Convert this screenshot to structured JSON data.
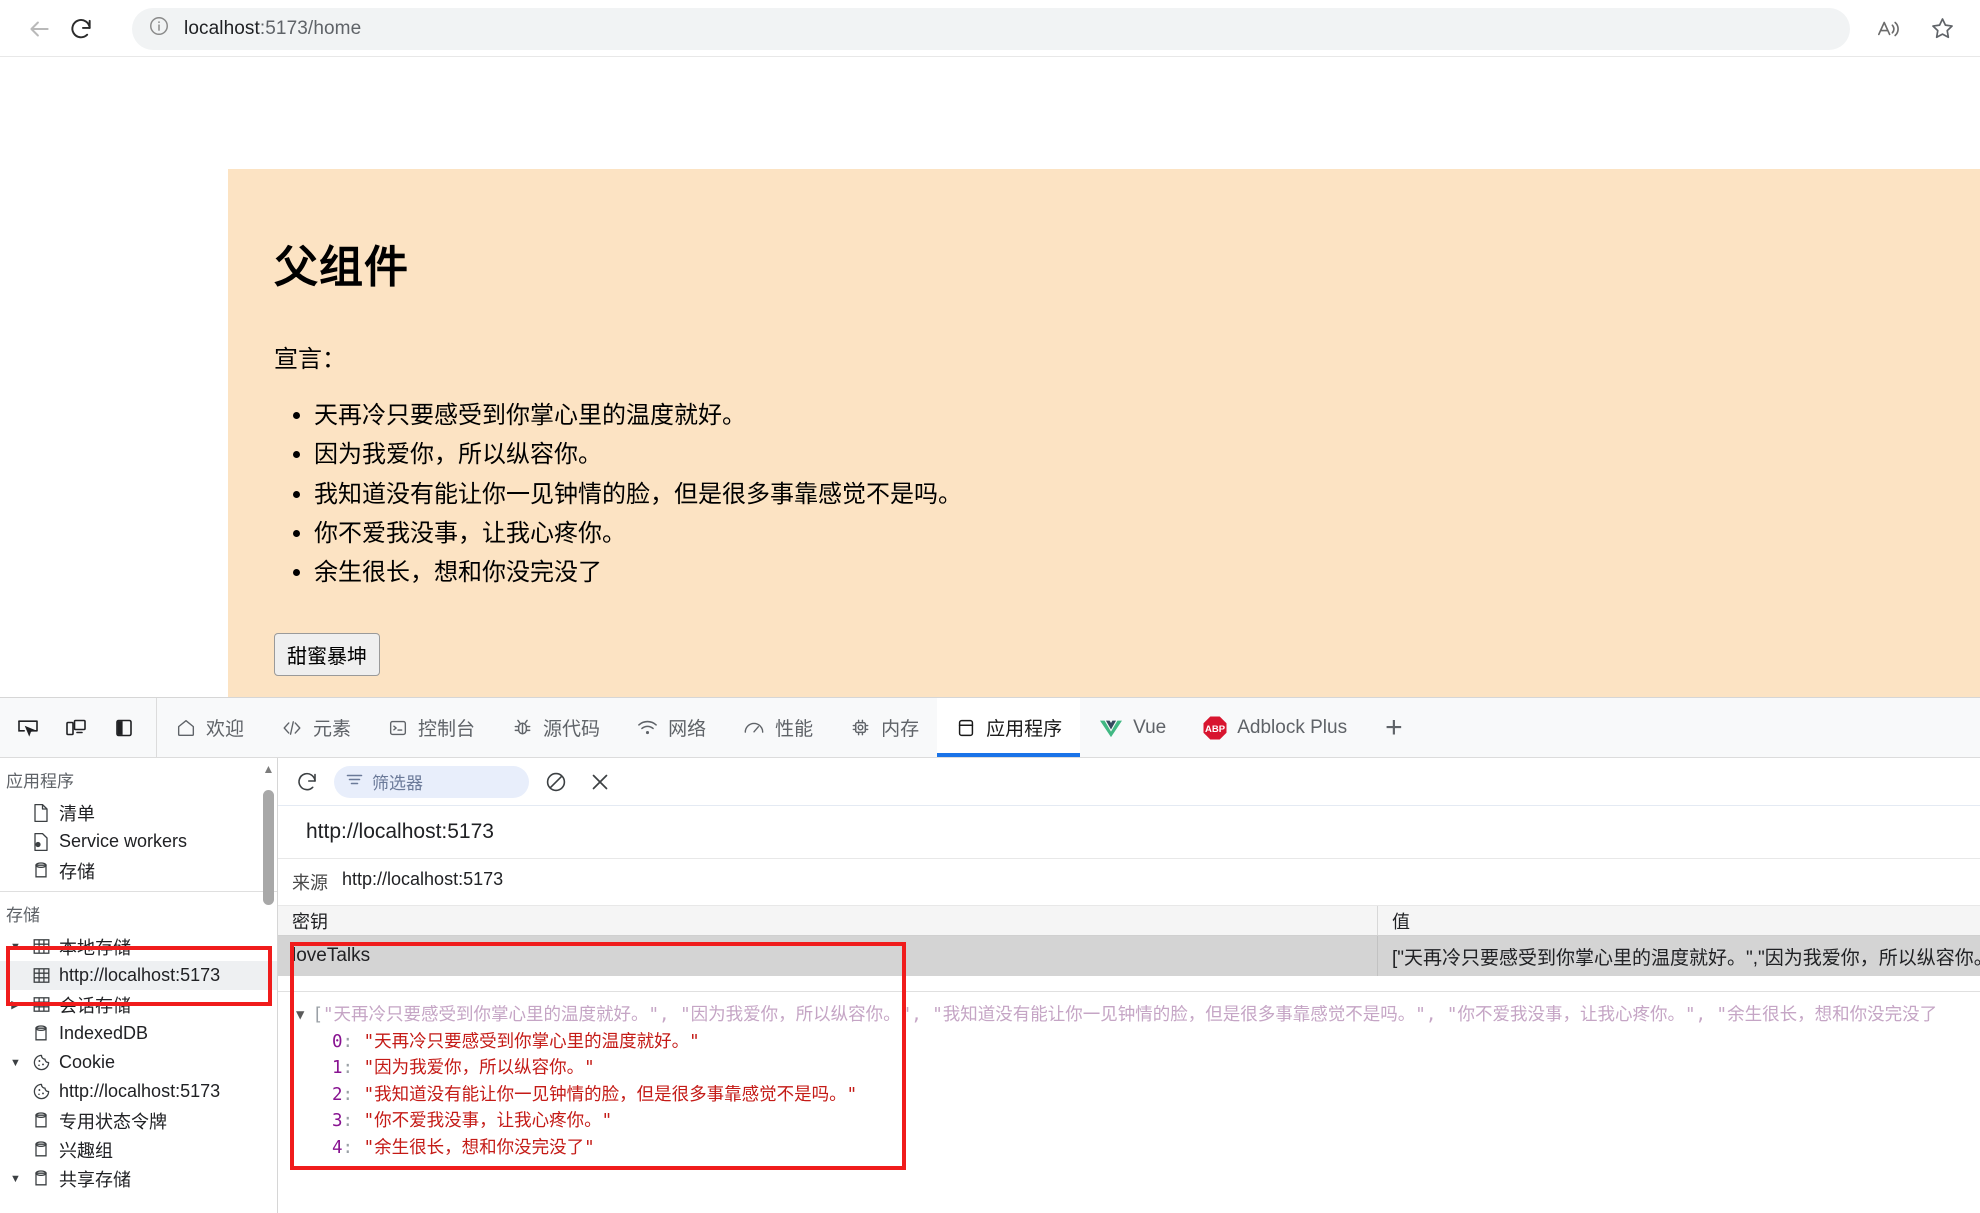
{
  "browser": {
    "back_icon": "back-arrow-icon",
    "reload_icon": "reload-icon",
    "info_icon": "info-circle-icon",
    "url_host": "localhost",
    "url_path": ":5173/home",
    "read_aloud_icon": "read-aloud-icon",
    "favorite_icon": "star-icon"
  },
  "page": {
    "heading": "父组件",
    "subtitle": "宣言：",
    "list": [
      "天再冷只要感受到你掌心里的温度就好。",
      "因为我爱你，所以纵容你。",
      "我知道没有能让你一见钟情的脸，但是很多事靠感觉不是吗。",
      "你不爱我没事，让我心疼你。",
      "余生很长，想和你没完没了"
    ],
    "button_label": "甜蜜暴坤",
    "background_color": "#fce3c3"
  },
  "devtools": {
    "tool_icons": [
      "inspect-element-icon",
      "device-toolbar-icon",
      "dock-side-icon"
    ],
    "tabs": [
      {
        "label": "欢迎",
        "icon": "home-icon",
        "active": false
      },
      {
        "label": "元素",
        "icon": "code-brackets-icon",
        "active": false
      },
      {
        "label": "控制台",
        "icon": "console-icon",
        "active": false
      },
      {
        "label": "源代码",
        "icon": "bug-icon",
        "active": false
      },
      {
        "label": "网络",
        "icon": "wifi-icon",
        "active": false
      },
      {
        "label": "性能",
        "icon": "gauge-icon",
        "active": false
      },
      {
        "label": "内存",
        "icon": "chip-icon",
        "active": false
      },
      {
        "label": "应用程序",
        "icon": "application-icon",
        "active": true
      },
      {
        "label": "Vue",
        "icon": "vue-logo-icon",
        "active": false
      },
      {
        "label": "Adblock Plus",
        "icon": "abp-logo-icon",
        "active": false
      }
    ],
    "add_tab_label": "+",
    "active_tab_accent": "#1a73e8",
    "sidebar": {
      "section_application": {
        "title": "应用程序",
        "items": [
          {
            "label": "清单",
            "icon": "manifest-file-icon"
          },
          {
            "label": "Service workers",
            "icon": "service-worker-icon"
          },
          {
            "label": "存储",
            "icon": "storage-cylinder-icon"
          }
        ]
      },
      "section_storage": {
        "title": "存储",
        "items": [
          {
            "label": "本地存储",
            "icon": "table-grid-icon",
            "arrow": "▼",
            "indent": 0,
            "selected": false,
            "highlighted": true
          },
          {
            "label": "http://localhost:5173",
            "icon": "table-grid-icon",
            "arrow": "",
            "indent": 1,
            "selected": true,
            "highlighted": true
          },
          {
            "label": "会话存储",
            "icon": "table-grid-icon",
            "arrow": "▶",
            "indent": 0,
            "selected": false,
            "highlighted": false
          },
          {
            "label": "IndexedDB",
            "icon": "storage-cylinder-icon",
            "arrow": "",
            "indent": 0,
            "selected": false,
            "highlighted": false
          },
          {
            "label": "Cookie",
            "icon": "cookie-icon",
            "arrow": "▼",
            "indent": 0,
            "selected": false,
            "highlighted": false
          },
          {
            "label": "http://localhost:5173",
            "icon": "cookie-icon",
            "arrow": "",
            "indent": 1,
            "selected": false,
            "highlighted": false
          },
          {
            "label": "专用状态令牌",
            "icon": "storage-cylinder-icon",
            "arrow": "",
            "indent": 0,
            "selected": false,
            "highlighted": false
          },
          {
            "label": "兴趣组",
            "icon": "storage-cylinder-icon",
            "arrow": "",
            "indent": 0,
            "selected": false,
            "highlighted": false
          },
          {
            "label": "共享存储",
            "icon": "storage-cylinder-icon",
            "arrow": "▼",
            "indent": 0,
            "selected": false,
            "highlighted": false
          }
        ]
      }
    },
    "toolbar": {
      "refresh_icon": "refresh-icon",
      "filter_placeholder": "筛选器",
      "filter_value": "",
      "filter_icon": "filter-lines-icon",
      "clear_all_icon": "clear-all-circle-slash-icon",
      "delete_selected_icon": "delete-x-icon"
    },
    "storage_panel": {
      "origin_title": "http://localhost:5173",
      "origin_label": "来源",
      "origin_value": "http://localhost:5173",
      "table": {
        "columns": [
          "密钥",
          "值"
        ],
        "rows": [
          {
            "key": "loveTalks",
            "value": "[\"天再冷只要感受到你掌心里的温度就好。\",\"因为我爱你，所以纵容你。\",\"我知道没有能让你一见钟情的脸，但是很多事靠感觉不是吗。\",\"你不爱我没事，让我心疼你。\",\"余生很长，想和你没完没了\"]",
            "selected": true
          }
        ]
      },
      "preview": {
        "toggle": "▼",
        "summary_open": "[",
        "summary": "\"天再冷只要感受到你掌心里的温度就好。\", \"因为我爱你，所以纵容你。\", \"我知道没有能让你一见钟情的脸，但是很多事靠感觉不是吗。\", \"你不爱我没事，让我心疼你。\", \"余生很长，想和你没完没了",
        "items": [
          {
            "index": "0",
            "value": "\"天再冷只要感受到你掌心里的温度就好。\""
          },
          {
            "index": "1",
            "value": "\"因为我爱你，所以纵容你。\""
          },
          {
            "index": "2",
            "value": "\"我知道没有能让你一见钟情的脸，但是很多事靠感觉不是吗。\""
          },
          {
            "index": "3",
            "value": "\"你不爱我没事，让我心疼你。\""
          },
          {
            "index": "4",
            "value": "\"余生很长，想和你没完没了\""
          }
        ]
      }
    }
  },
  "annotations": {
    "color": "#f01c1c",
    "boxes": [
      {
        "name": "local-storage-tree-highlight"
      },
      {
        "name": "storage-value-highlight"
      }
    ]
  }
}
